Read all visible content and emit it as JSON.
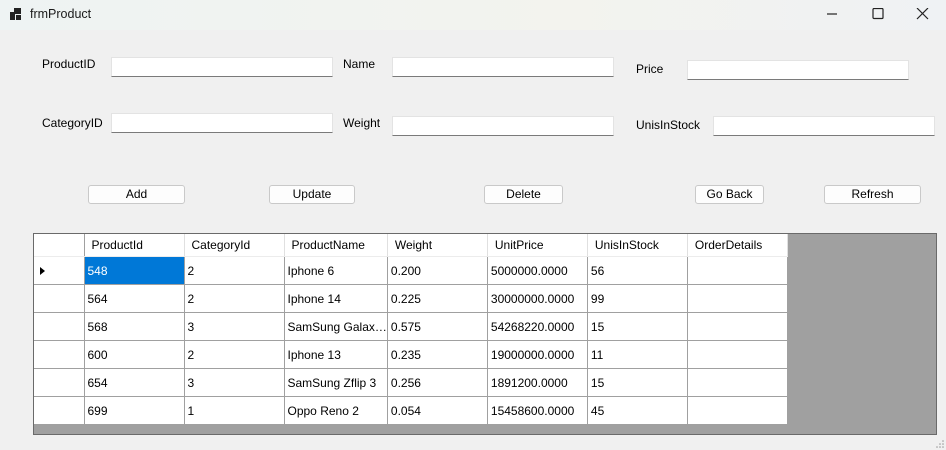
{
  "window": {
    "title": "frmProduct",
    "icons": {
      "app": "app-form-icon",
      "minimize": "minimize-icon",
      "maximize": "maximize-icon",
      "close": "close-icon"
    }
  },
  "form": {
    "fields": {
      "product_id": {
        "label": "ProductID",
        "value": ""
      },
      "name": {
        "label": "Name",
        "value": ""
      },
      "price": {
        "label": "Price",
        "value": ""
      },
      "category_id": {
        "label": "CategoryID",
        "value": ""
      },
      "weight": {
        "label": "Weight",
        "value": ""
      },
      "units_in_stock": {
        "label": "UnisInStock",
        "value": ""
      }
    },
    "buttons": {
      "add": "Add",
      "update": "Update",
      "delete": "Delete",
      "go_back": "Go Back",
      "refresh": "Refresh"
    }
  },
  "grid": {
    "columns": [
      "ProductId",
      "CategoryId",
      "ProductName",
      "Weight",
      "UnitPrice",
      "UnisInStock",
      "OrderDetails"
    ],
    "rows": [
      [
        "548",
        "2",
        "Iphone 6",
        "0.200",
        "5000000.0000",
        "56",
        ""
      ],
      [
        "564",
        "2",
        "Iphone 14",
        "0.225",
        "30000000.0000",
        "99",
        ""
      ],
      [
        "568",
        "3",
        "SamSung Galax…",
        "0.575",
        "54268220.0000",
        "15",
        ""
      ],
      [
        "600",
        "2",
        "Iphone 13",
        "0.235",
        "19000000.0000",
        "11",
        ""
      ],
      [
        "654",
        "3",
        "SamSung Zflip 3",
        "0.256",
        "1891200.0000",
        "15",
        ""
      ],
      [
        "699",
        "1",
        "Oppo Reno 2",
        "0.054",
        "15458600.0000",
        "45",
        ""
      ]
    ],
    "current_row_indicator": "row-pointer-icon",
    "selection_color": "#0078d7",
    "empty_area_color": "#a0a0a0"
  }
}
